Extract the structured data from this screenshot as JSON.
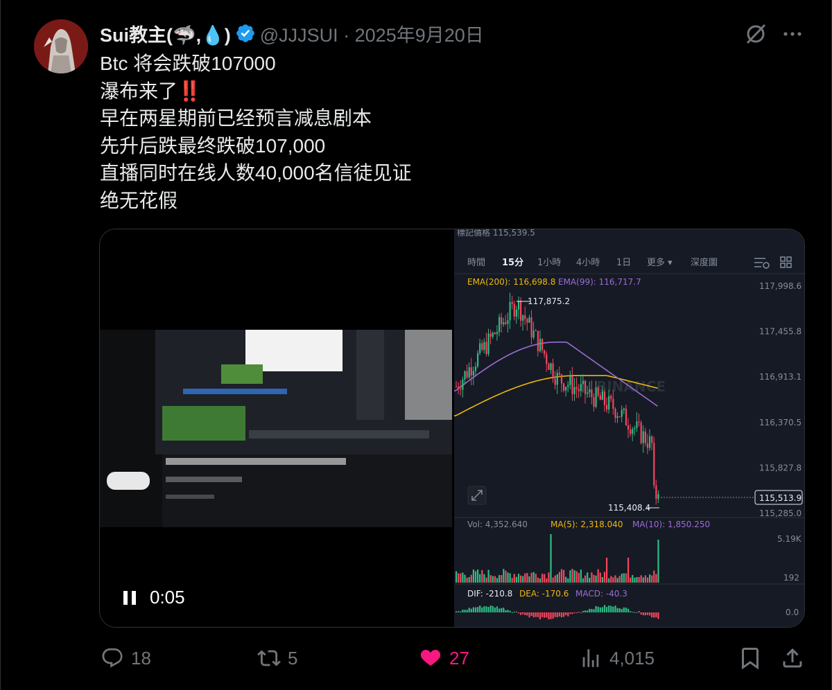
{
  "tweet": {
    "display_name": "Sui教主(🦈,💧)",
    "handle_date": "@JJJSUI · 2025年9月20日",
    "lines": [
      "Btc 将会跌破107000",
      "瀑布来了‼️",
      "早在两星期前已经预言减息剧本",
      "先升后跌最终跌破107,000",
      "直播同时在线人数40,000名信徒见证",
      "绝无花假"
    ]
  },
  "video": {
    "time": "0:05"
  },
  "chart_panel": {
    "mark_price_label": "標記價格 115,539.5",
    "tabs": [
      "時間",
      "15分",
      "1小時",
      "4小時",
      "1日",
      "更多 ▾",
      "深度圖"
    ],
    "active_tab": "15分",
    "ema_200": "EMA(200): 116,698.8",
    "ema_99": "EMA(99): 116,717.7",
    "high_label": "117,875.2",
    "low_label": "115,408.4",
    "current_price": "115,513.9",
    "watermark": "BINANCE",
    "vol": "Vol: 4,352.640",
    "ma5": "MA(5): 2,318.040",
    "ma10": "MA(10): 1,850.250",
    "vol_ticks": [
      "5.19K",
      "192"
    ],
    "dif": "DIF: -210.8",
    "dea": "DEA: -170.6",
    "macd": "MACD: -40.3",
    "macd_tick": "0.0",
    "colors": {
      "up": "#2ebd85",
      "down": "#f6465d",
      "ema200": "#f0b90b",
      "ema99": "#9b6dd7"
    }
  },
  "chart_data": {
    "type": "candlestick",
    "price_axis_ticks": [
      117998.6,
      117455.8,
      116913.1,
      116370.5,
      115827.8,
      115285.0
    ],
    "ylim": [
      115285.0,
      117998.6
    ],
    "high": 117875.2,
    "low": 115408.4,
    "last": 115513.9
  },
  "actions": {
    "replies": "18",
    "retweets": "5",
    "likes": "27",
    "views": "4,015"
  }
}
